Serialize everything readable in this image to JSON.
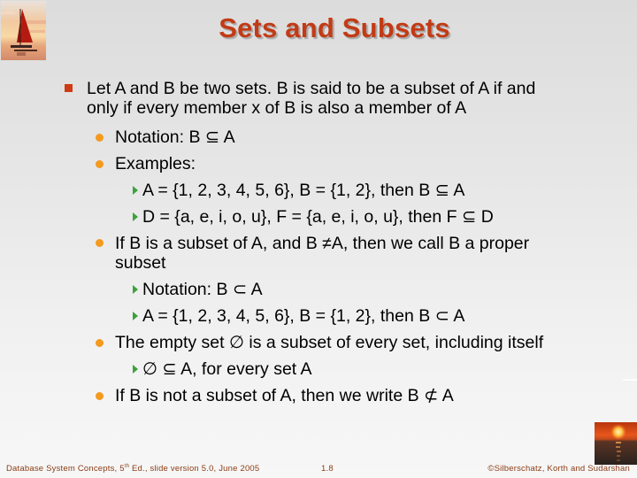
{
  "slide": {
    "title": "Sets and Subsets",
    "logo_top": "sailboat-sunset-image",
    "logo_bottom": "sunset-over-water-image"
  },
  "content": {
    "items": [
      {
        "level": 1,
        "text_line1": "Let A and B be two sets. B is said to be a subset of A if and",
        "text_line2": "only if every member x of B is also a member of A"
      },
      {
        "level": 2,
        "text": "Notation: B ⊆ A"
      },
      {
        "level": 2,
        "text": "Examples:"
      },
      {
        "level": 3,
        "text": "A = {1, 2, 3, 4, 5, 6}, B = {1, 2}, then B ⊆ A"
      },
      {
        "level": 3,
        "text": "D = {a, e, i, o, u}, F = {a, e, i, o, u}, then  F ⊆ D"
      },
      {
        "level": 2,
        "text_line1": "If B is a subset of A, and B ≠A, then we call B a proper",
        "text_line2": "subset"
      },
      {
        "level": 3,
        "text": "Notation: B ⊂ A"
      },
      {
        "level": 3,
        "text": "A = {1, 2, 3, 4, 5, 6}, B = {1, 2}, then B ⊂ A"
      },
      {
        "level": 2,
        "text": "The empty set ∅ is a subset of every set, including itself"
      },
      {
        "level": 3,
        "text": "∅ ⊆  A, for every set A"
      },
      {
        "level": 2,
        "text": "If B is not a subset of A, then we write B ⊄ A"
      }
    ]
  },
  "footer": {
    "left_prefix": "Database System Concepts, 5",
    "left_sup": "th",
    "left_suffix": " Ed., slide version 5.0, June 2005",
    "page": "1.8",
    "copyright": "©Silberschatz, Korth and Sudarshan"
  },
  "colors": {
    "title": "#c23b16",
    "level1_bullet": "#cf3b12",
    "level2_bullet": "#f39a1f",
    "level3_bullet": "#3ca13c",
    "footer_text": "#8a3c14"
  }
}
